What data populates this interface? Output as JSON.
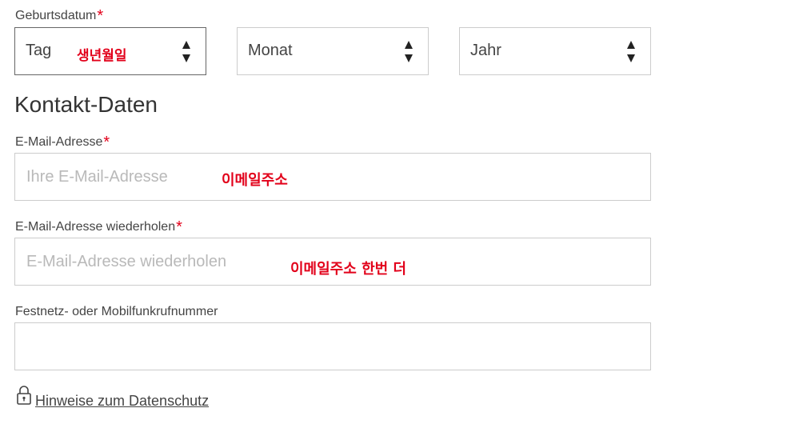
{
  "birthdate": {
    "label": "Geburtsdatum",
    "required_mark": "*",
    "day": {
      "value": "Tag",
      "annotation": "생년월일"
    },
    "month": {
      "value": "Monat"
    },
    "year": {
      "value": "Jahr"
    }
  },
  "contact": {
    "heading": "Kontakt-Daten",
    "email": {
      "label": "E-Mail-Adresse",
      "required_mark": "*",
      "placeholder": "Ihre E-Mail-Adresse",
      "annotation": "이메일주소"
    },
    "email_repeat": {
      "label": "E-Mail-Adresse wiederholen",
      "required_mark": "*",
      "placeholder": "E-Mail-Adresse wiederholen",
      "annotation": "이메일주소 한번 더"
    },
    "phone": {
      "label": "Festnetz- oder Mobilfunkrufnummer",
      "value": ""
    }
  },
  "privacy": {
    "icon": "lock-icon",
    "link_text": "Hinweise zum Datenschutz"
  },
  "colors": {
    "required": "#e2001a",
    "annotation": "#e2001a",
    "border": "#cccccc",
    "placeholder": "#b9b9b9"
  }
}
